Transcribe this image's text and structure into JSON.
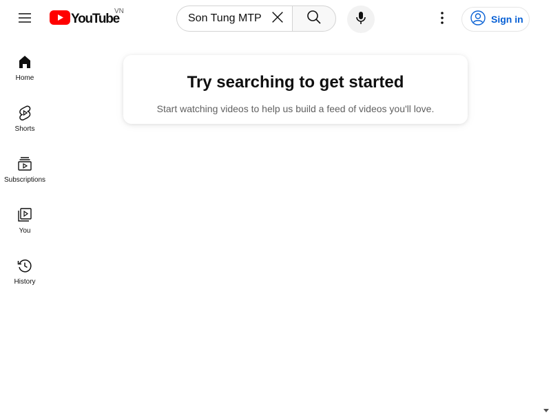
{
  "header": {
    "logo_text": "YouTube",
    "country_code": "VN",
    "brand_color": "#ff0000",
    "menu_icon": "hamburger-menu-icon",
    "search": {
      "value": "Son Tung MTP",
      "placeholder": "Search",
      "clear_icon": "close-icon",
      "search_icon": "search-icon",
      "mic_icon": "microphone-icon"
    },
    "more_icon": "vertical-dots-icon",
    "signin_label": "Sign in",
    "signin_icon": "account-circle-icon",
    "link_color": "#065fd4"
  },
  "sidebar": {
    "items": [
      {
        "label": "Home",
        "icon": "home-icon"
      },
      {
        "label": "Shorts",
        "icon": "shorts-icon"
      },
      {
        "label": "Subscriptions",
        "icon": "subscriptions-icon"
      },
      {
        "label": "You",
        "icon": "you-library-icon"
      },
      {
        "label": "History",
        "icon": "history-icon"
      }
    ]
  },
  "main": {
    "empty_title": "Try searching to get started",
    "empty_subtitle": "Start watching videos to help us build a feed of videos you'll love."
  }
}
